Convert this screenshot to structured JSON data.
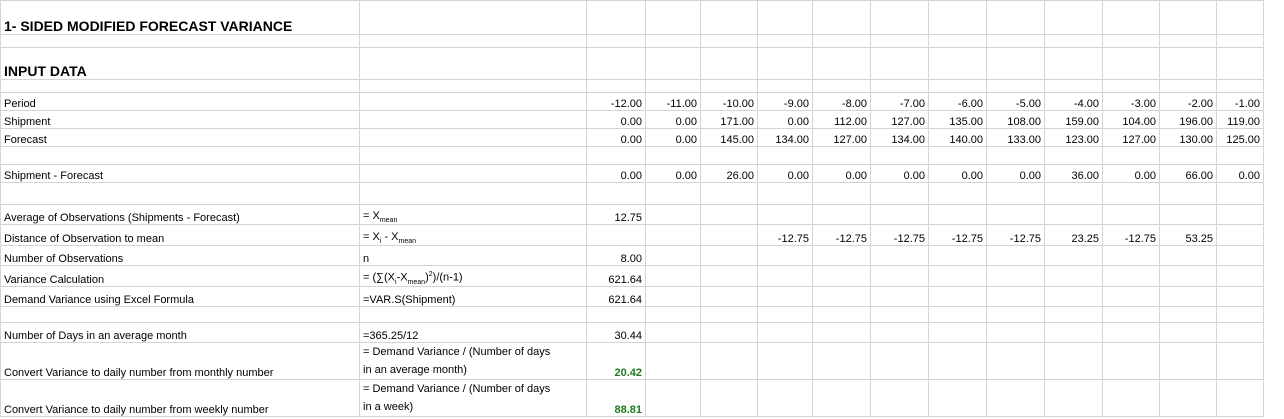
{
  "title": "1- SIDED MODIFIED FORECAST VARIANCE",
  "input_header": "INPUT DATA",
  "rows": {
    "period": {
      "label": "Period",
      "values": [
        "-12.00",
        "-11.00",
        "-10.00",
        "-9.00",
        "-8.00",
        "-7.00",
        "-6.00",
        "-5.00",
        "-4.00",
        "-3.00",
        "-2.00",
        "-1.00"
      ]
    },
    "shipment": {
      "label": "Shipment",
      "values": [
        "0.00",
        "0.00",
        "171.00",
        "0.00",
        "112.00",
        "127.00",
        "135.00",
        "108.00",
        "159.00",
        "104.00",
        "196.00",
        "119.00"
      ]
    },
    "forecast": {
      "label": "Forecast",
      "values": [
        "0.00",
        "0.00",
        "145.00",
        "134.00",
        "127.00",
        "134.00",
        "140.00",
        "133.00",
        "123.00",
        "127.00",
        "130.00",
        "125.00"
      ]
    },
    "diff": {
      "label": "Shipment - Forecast",
      "values": [
        "0.00",
        "0.00",
        "26.00",
        "0.00",
        "0.00",
        "0.00",
        "0.00",
        "0.00",
        "36.00",
        "0.00",
        "66.00",
        "0.00"
      ]
    }
  },
  "stats": {
    "avg": {
      "label": "Average of Observations (Shipments - Forecast)",
      "formula_prefix": "= X",
      "formula_sub": "mean",
      "value": "12.75"
    },
    "dist": {
      "label": "Distance of Observation to mean",
      "formula_a": "= X",
      "formula_sub_i": "i",
      "formula_mid": " - X",
      "formula_sub_mean": "mean",
      "values": [
        "",
        "",
        "",
        "-12.75",
        "-12.75",
        "-12.75",
        "-12.75",
        "-12.75",
        "23.25",
        "-12.75",
        "53.25",
        ""
      ]
    },
    "n": {
      "label": "Number of Observations",
      "formula": "n",
      "value": "8.00"
    },
    "var": {
      "label": "Variance Calculation",
      "f1": "= (∑(X",
      "f_sub_i": "i",
      "f2": "-X",
      "f_sub_mean": "mean",
      "f3": ")",
      "f_sup": "2",
      "f4": ")/(n-1)",
      "value": "621.64"
    },
    "excel": {
      "label": "Demand Variance using Excel Formula",
      "formula": "=VAR.S(Shipment)",
      "value": "621.64"
    },
    "days": {
      "label": "Number of Days in an average month",
      "formula": "=365.25/12",
      "value": "30.44"
    },
    "monthly": {
      "label": "Convert Variance to daily number from monthly number",
      "formula_l1": "= Demand Variance / (Number of days",
      "formula_l2": "in an average month)",
      "value": "20.42"
    },
    "weekly": {
      "label": "Convert Variance to daily number from weekly number",
      "formula_l1": "= Demand Variance / (Number of days",
      "formula_l2": "in a week)",
      "value": "88.81"
    }
  }
}
